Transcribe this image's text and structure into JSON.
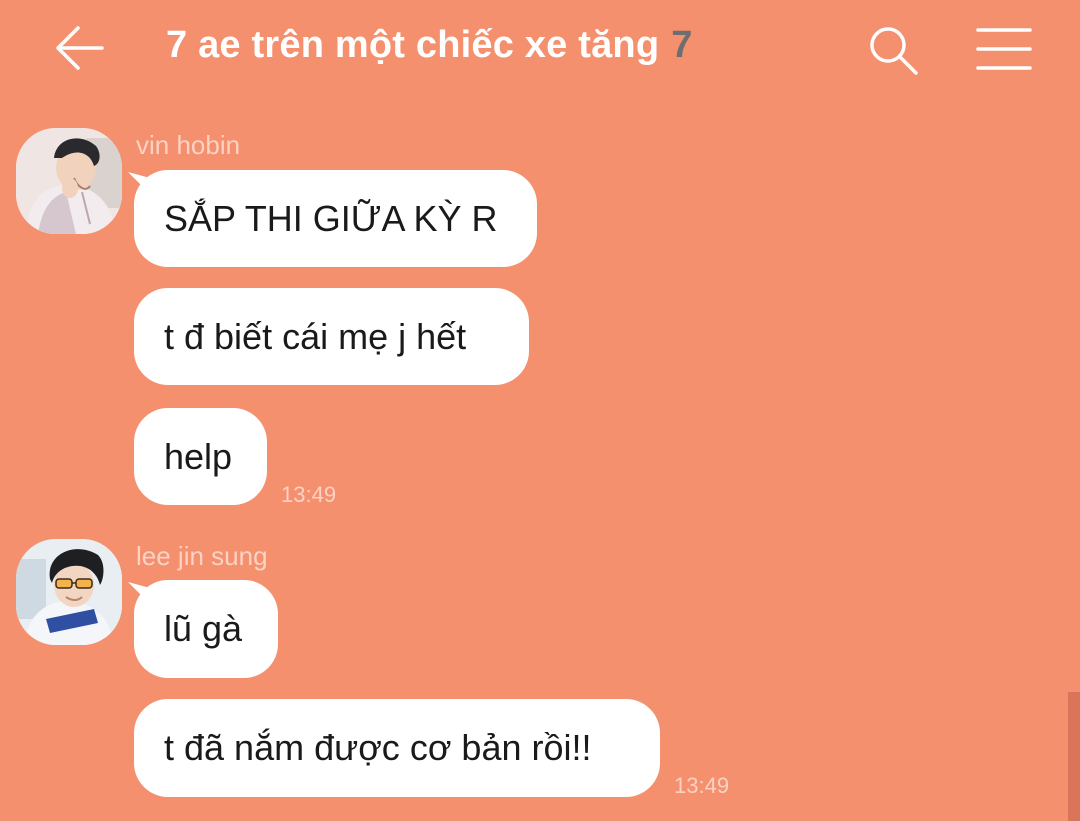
{
  "header": {
    "title": "7 ae trên một chiếc xe tăng",
    "member_count": "7",
    "back_icon": "arrow-left-icon",
    "search_icon": "search-icon",
    "menu_icon": "hamburger-menu-icon"
  },
  "messages": [
    {
      "sender": "vin hobin",
      "bubbles": [
        "SẮP THI GIỮA KỲ R",
        "t đ biết cái mẹ j hết",
        "help"
      ],
      "time": "13:49"
    },
    {
      "sender": "lee jin sung",
      "bubbles": [
        "lũ gà",
        "t đã nắm được cơ bản rồi!!"
      ],
      "time": "13:49"
    }
  ],
  "colors": {
    "background": "#f5906f",
    "bubble": "#ffffff",
    "member_count": "#6e6e6e"
  }
}
